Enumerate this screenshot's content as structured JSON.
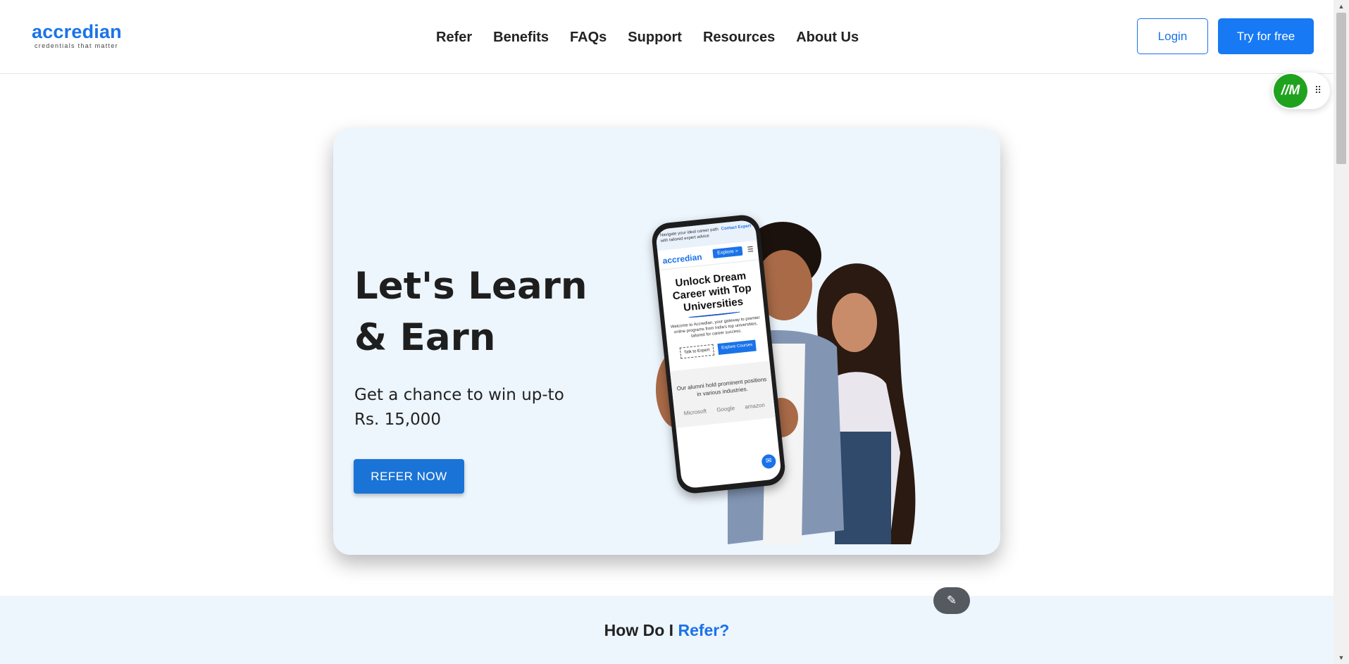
{
  "header": {
    "logo_name": "accredian",
    "logo_tagline": "credentials that matter",
    "nav": [
      "Refer",
      "Benefits",
      "FAQs",
      "Support",
      "Resources",
      "About Us"
    ],
    "login_label": "Login",
    "try_label": "Try for free"
  },
  "widget": {
    "logo_text": "//M",
    "icon": "drag-handle-icon"
  },
  "hero": {
    "title_line1": "Let's Learn",
    "title_line2": "& Earn",
    "subtitle_line1": "Get a chance to win up-to",
    "subtitle_line2": "Rs. 15,000",
    "refer_label": "REFER NOW"
  },
  "phone": {
    "top_text": "Navigate your ideal career path with tailored expert advice",
    "contact_label": "Contact Expert",
    "logo": "accredian",
    "explore_label": "Explore >",
    "heading": "Unlock Dream Career with Top Universities",
    "welcome_text": "Welcome to Accredian, your gateway to premier online programs from India's top universities, tailored for career success.",
    "talk_label": "Talk to Expert",
    "courses_label": "Explore Courses",
    "alumni_text": "Our alumni hold prominent positions in various industries.",
    "companies": [
      "Microsoft",
      "Google",
      "amazon"
    ]
  },
  "how": {
    "title_prefix": "How Do I ",
    "title_accent": "Refer?"
  },
  "colors": {
    "brand_blue": "#1a73e8",
    "hero_bg": "#edf5fd",
    "widget_green": "#1fa31f"
  }
}
